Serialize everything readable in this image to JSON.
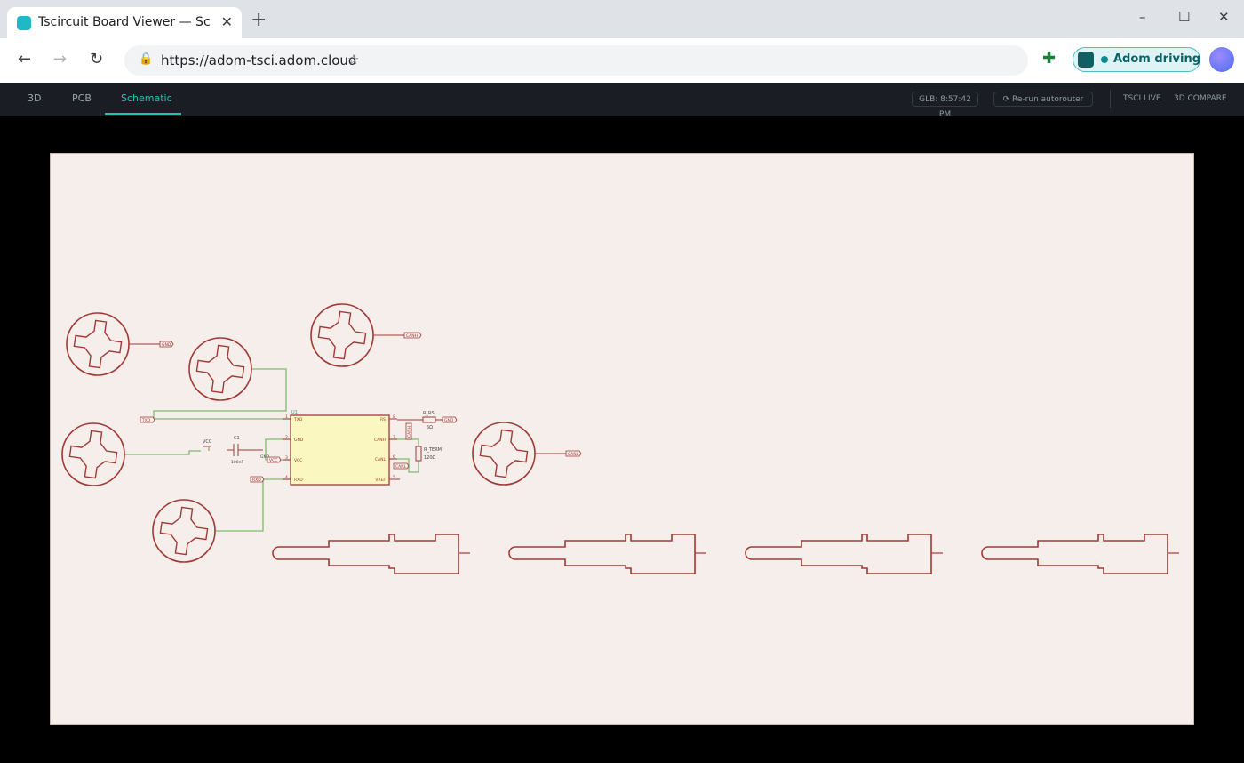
{
  "browser": {
    "tab_title": "Tscircuit Board Viewer — Sc...",
    "url": "https://adom-tsci.adom.cloud",
    "extension_badge": "Adom driving"
  },
  "app": {
    "tabs": [
      "3D",
      "PCB",
      "Schematic"
    ],
    "active_tab": "Schematic",
    "glb_status": "GLB: 8:57:42 PM",
    "rerun_label": "Re-run autorouter",
    "links": [
      "TSCI LIVE",
      "3D COMPARE"
    ]
  },
  "schematic": {
    "chip": {
      "ref": "U1",
      "left_pins": [
        {
          "num": "1",
          "name": "TXD"
        },
        {
          "num": "2",
          "name": "GND"
        },
        {
          "num": "3",
          "name": "VCC"
        },
        {
          "num": "4",
          "name": "RXD"
        }
      ],
      "right_pins": [
        {
          "num": "8",
          "name": "RS"
        },
        {
          "num": "7",
          "name": "CANH"
        },
        {
          "num": "6",
          "name": "CANL"
        },
        {
          "num": "5",
          "name": "VREF"
        }
      ]
    },
    "net_labels": [
      "GND",
      "CANH",
      "TXD",
      "VCC",
      "CANL",
      "RXD",
      "GND",
      "CANH",
      "CANL"
    ],
    "components": {
      "r_rs": {
        "ref": "R_RS",
        "value": "5Ω"
      },
      "r_term": {
        "ref": "R_TERM",
        "value": "120Ω"
      },
      "c1": {
        "ref": "C1",
        "value": "100nF"
      },
      "vcc_symbol": "VCC",
      "gnd_symbol": "GND"
    }
  },
  "colors": {
    "schematic_line": "#a03a36",
    "trace": "#7dbb6e",
    "chip_fill": "#faf7c0",
    "accent": "#1cc3b6"
  }
}
